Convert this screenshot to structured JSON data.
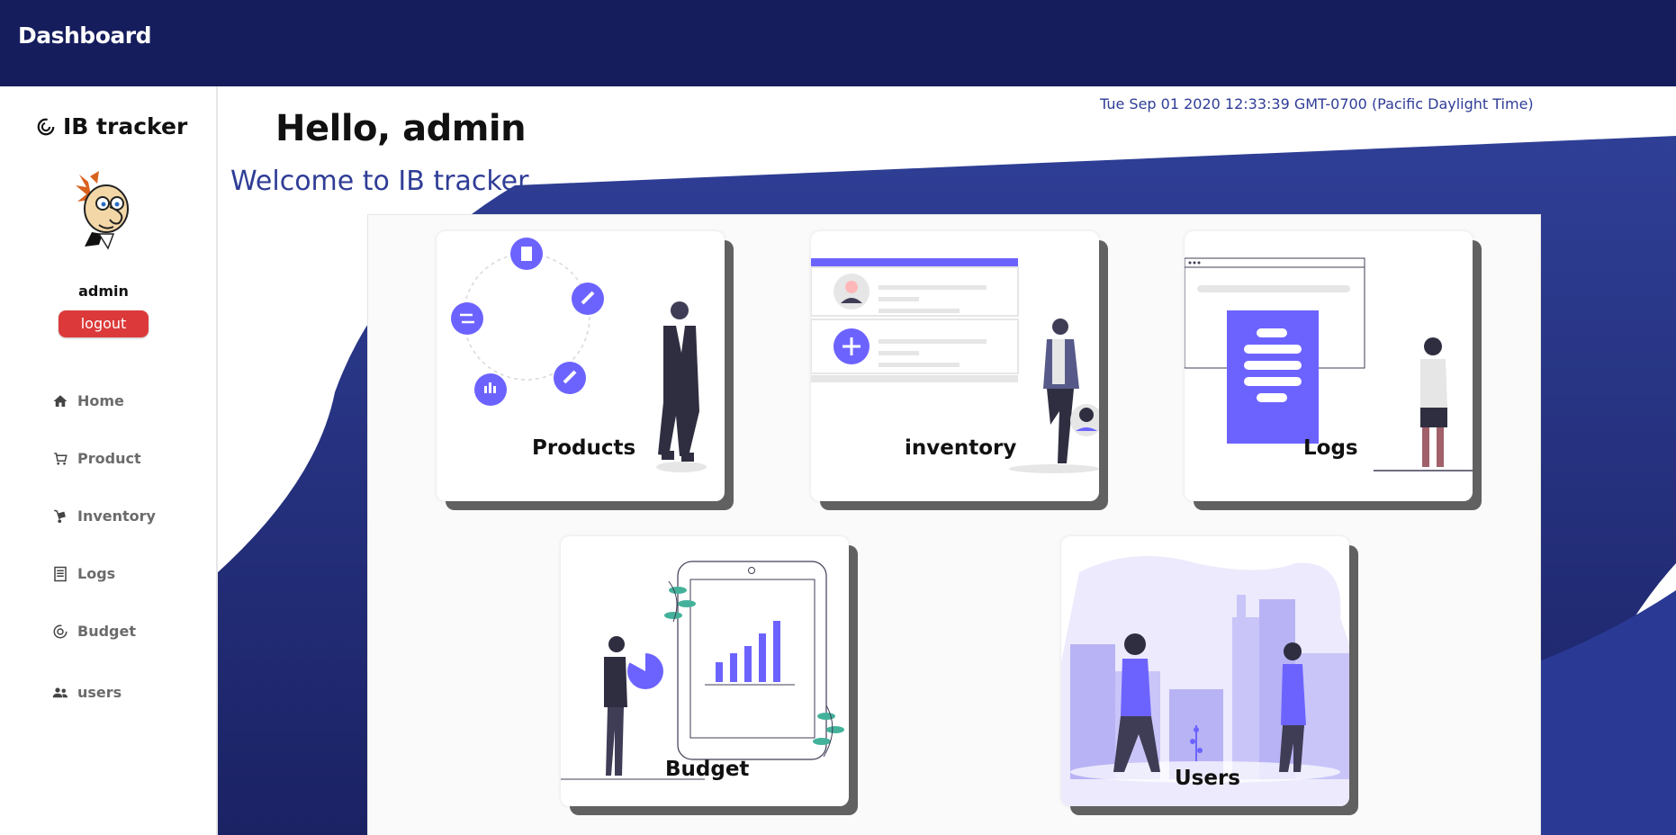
{
  "header": {
    "title": "Dashboard"
  },
  "sidebar": {
    "brand": "IB tracker",
    "user": "admin",
    "logout_label": "logout",
    "items": [
      {
        "label": "Home",
        "icon": "home-icon"
      },
      {
        "label": "Product",
        "icon": "cart-icon"
      },
      {
        "label": "Inventory",
        "icon": "hand-truck-icon"
      },
      {
        "label": "Logs",
        "icon": "document-icon"
      },
      {
        "label": "Budget",
        "icon": "budget-icon"
      },
      {
        "label": "users",
        "icon": "users-icon"
      }
    ]
  },
  "main": {
    "greeting": "Hello, admin",
    "welcome": "Welcome to IB tracker",
    "datetime": "Tue Sep 01 2020 12:33:39 GMT-0700 (Pacific Daylight Time)",
    "cards": [
      {
        "label": "Products"
      },
      {
        "label": "inventory"
      },
      {
        "label": "Logs"
      },
      {
        "label": "Budget"
      },
      {
        "label": "Users"
      }
    ]
  },
  "colors": {
    "header": "#161d5d",
    "accent": "#6c63ff",
    "logout": "#dc3a3a",
    "welcome_text": "#2f3d96"
  }
}
